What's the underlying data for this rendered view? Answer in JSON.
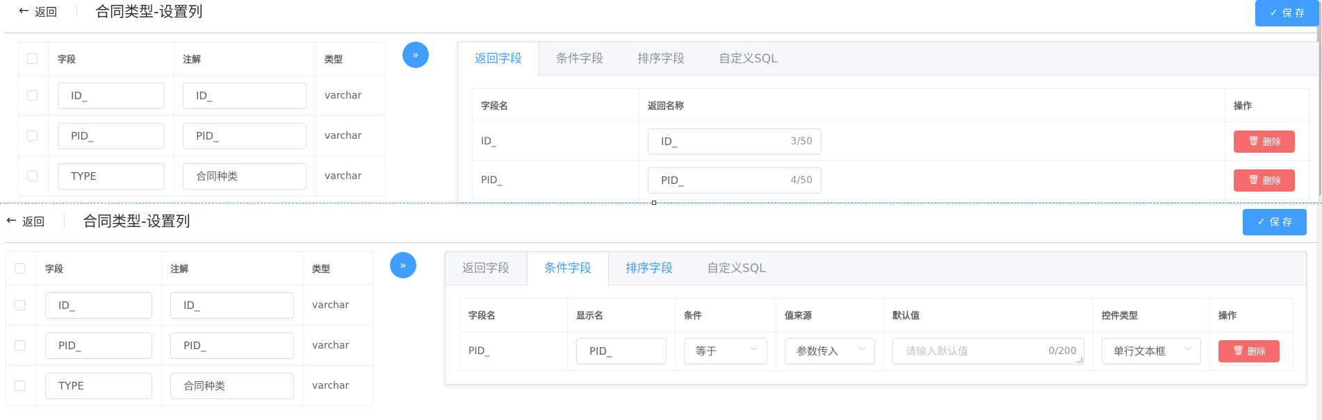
{
  "colors": {
    "accent": "#409eff",
    "danger": "#f56c6c",
    "border": "#dcdfe6"
  },
  "icons": {
    "back": "arrow-left-icon",
    "save": "check-icon",
    "move": "double-chevron-right-icon",
    "delete": "trash-icon",
    "select": "chevron-down-icon"
  },
  "header": {
    "back_label": "返回",
    "title": "合同类型-设置列",
    "save_label": "保 存"
  },
  "source_table": {
    "columns": [
      "字段",
      "注解",
      "类型"
    ],
    "rows": [
      {
        "field": "ID_",
        "comment": "ID_",
        "type": "varchar"
      },
      {
        "field": "PID_",
        "comment": "PID_",
        "type": "varchar"
      },
      {
        "field": "TYPE",
        "comment": "合同种类",
        "type": "varchar"
      }
    ]
  },
  "tabs": [
    "返回字段",
    "条件字段",
    "排序字段",
    "自定义SQL"
  ],
  "return_fields": {
    "columns": [
      "字段名",
      "返回名称",
      "操作"
    ],
    "rows": [
      {
        "field": "ID_",
        "name": "ID_",
        "count": "3/50"
      },
      {
        "field": "PID_",
        "name": "PID_",
        "count": "4/50"
      }
    ],
    "delete_label": "删除"
  },
  "condition_fields": {
    "columns": [
      "字段名",
      "显示名",
      "条件",
      "值来源",
      "默认值",
      "控件类型",
      "操作"
    ],
    "rows": [
      {
        "field": "PID_",
        "display": "PID_",
        "condition": "等于",
        "source": "参数传入",
        "default_placeholder": "请输入默认值",
        "default_count": "0/200",
        "control": "单行文本框"
      }
    ],
    "delete_label": "删除"
  }
}
